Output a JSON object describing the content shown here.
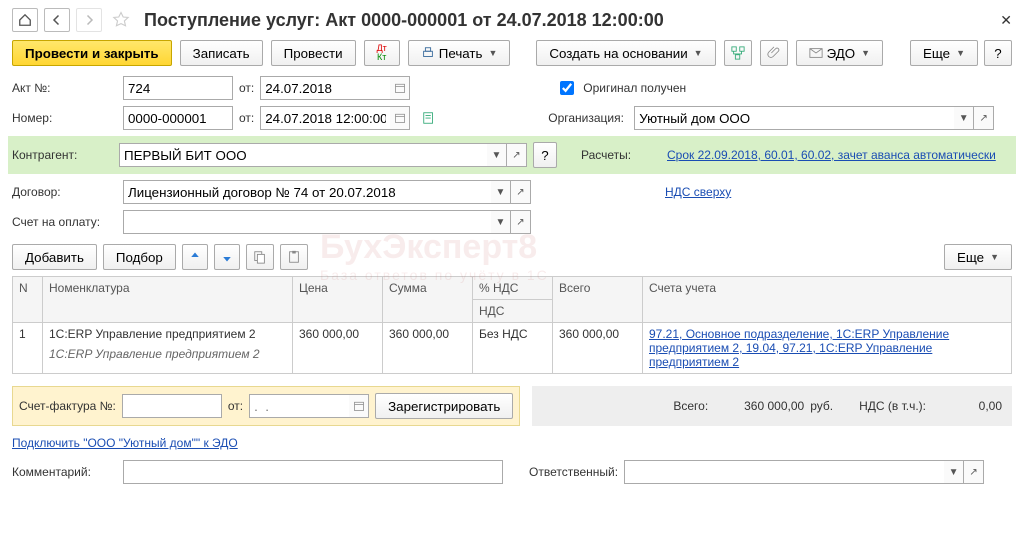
{
  "title": "Поступление услуг: Акт 0000-000001 от 24.07.2018 12:00:00",
  "toolbar": {
    "post_close": "Провести и закрыть",
    "save": "Записать",
    "post": "Провести",
    "print": "Печать",
    "create_based": "Создать на основании",
    "edo": "ЭДО",
    "more": "Еще",
    "help": "?"
  },
  "act": {
    "no_label": "Акт №:",
    "no_value": "724",
    "from_label": "от:",
    "date_value": "24.07.2018",
    "original_label": "Оригинал получен"
  },
  "doc": {
    "num_label": "Номер:",
    "num_value": "0000-000001",
    "from_label": "от:",
    "dt_value": "24.07.2018 12:00:00",
    "org_label": "Организация:",
    "org_value": "Уютный дом ООО"
  },
  "counterparty": {
    "label": "Контрагент:",
    "value": "ПЕРВЫЙ БИТ ООО",
    "help": "?",
    "calc_label": "Расчеты:",
    "calc_link": "Срок 22.09.2018, 60.01, 60.02, зачет аванса автоматически"
  },
  "contract": {
    "label": "Договор:",
    "value": "Лицензионный договор № 74 от 20.07.2018",
    "vat_link": "НДС сверху"
  },
  "invoice_acc": {
    "label": "Счет на оплату:"
  },
  "subtoolbar": {
    "add": "Добавить",
    "pick": "Подбор",
    "more": "Еще"
  },
  "grid": {
    "headers": {
      "n": "N",
      "nom": "Номенклатура",
      "price": "Цена",
      "sum": "Сумма",
      "vatpct": "% НДС",
      "vat": "НДС",
      "total": "Всего",
      "accounts": "Счета учета"
    },
    "rows": [
      {
        "n": "1",
        "nom_top": "1С:ERP Управление предприятием 2",
        "nom_bottom": "1С:ERP Управление предприятием 2",
        "price": "360 000,00",
        "sum": "360 000,00",
        "vatpct": "Без НДС",
        "total": "360 000,00",
        "accounts": "97.21, Основное подразделение, 1С:ERP Управление предприятием 2, 19.04, 97.21, 1С:ERP Управление предприятием 2"
      }
    ]
  },
  "invoice": {
    "label": "Счет-фактура №:",
    "from": "от:",
    "date_placeholder": ".  .",
    "register": "Зарегистрировать"
  },
  "totals": {
    "total_label": "Всего:",
    "total_value": "360 000,00",
    "currency": "руб.",
    "vat_label": "НДС (в т.ч.):",
    "vat_value": "0,00"
  },
  "edo_link": "Подключить \"ООО \"Уютный дом\"\" к ЭДО",
  "comment": {
    "label": "Комментарий:",
    "resp_label": "Ответственный:"
  },
  "watermark": {
    "main": "БухЭксперт8",
    "sub": "База ответов по учёту в 1С"
  }
}
